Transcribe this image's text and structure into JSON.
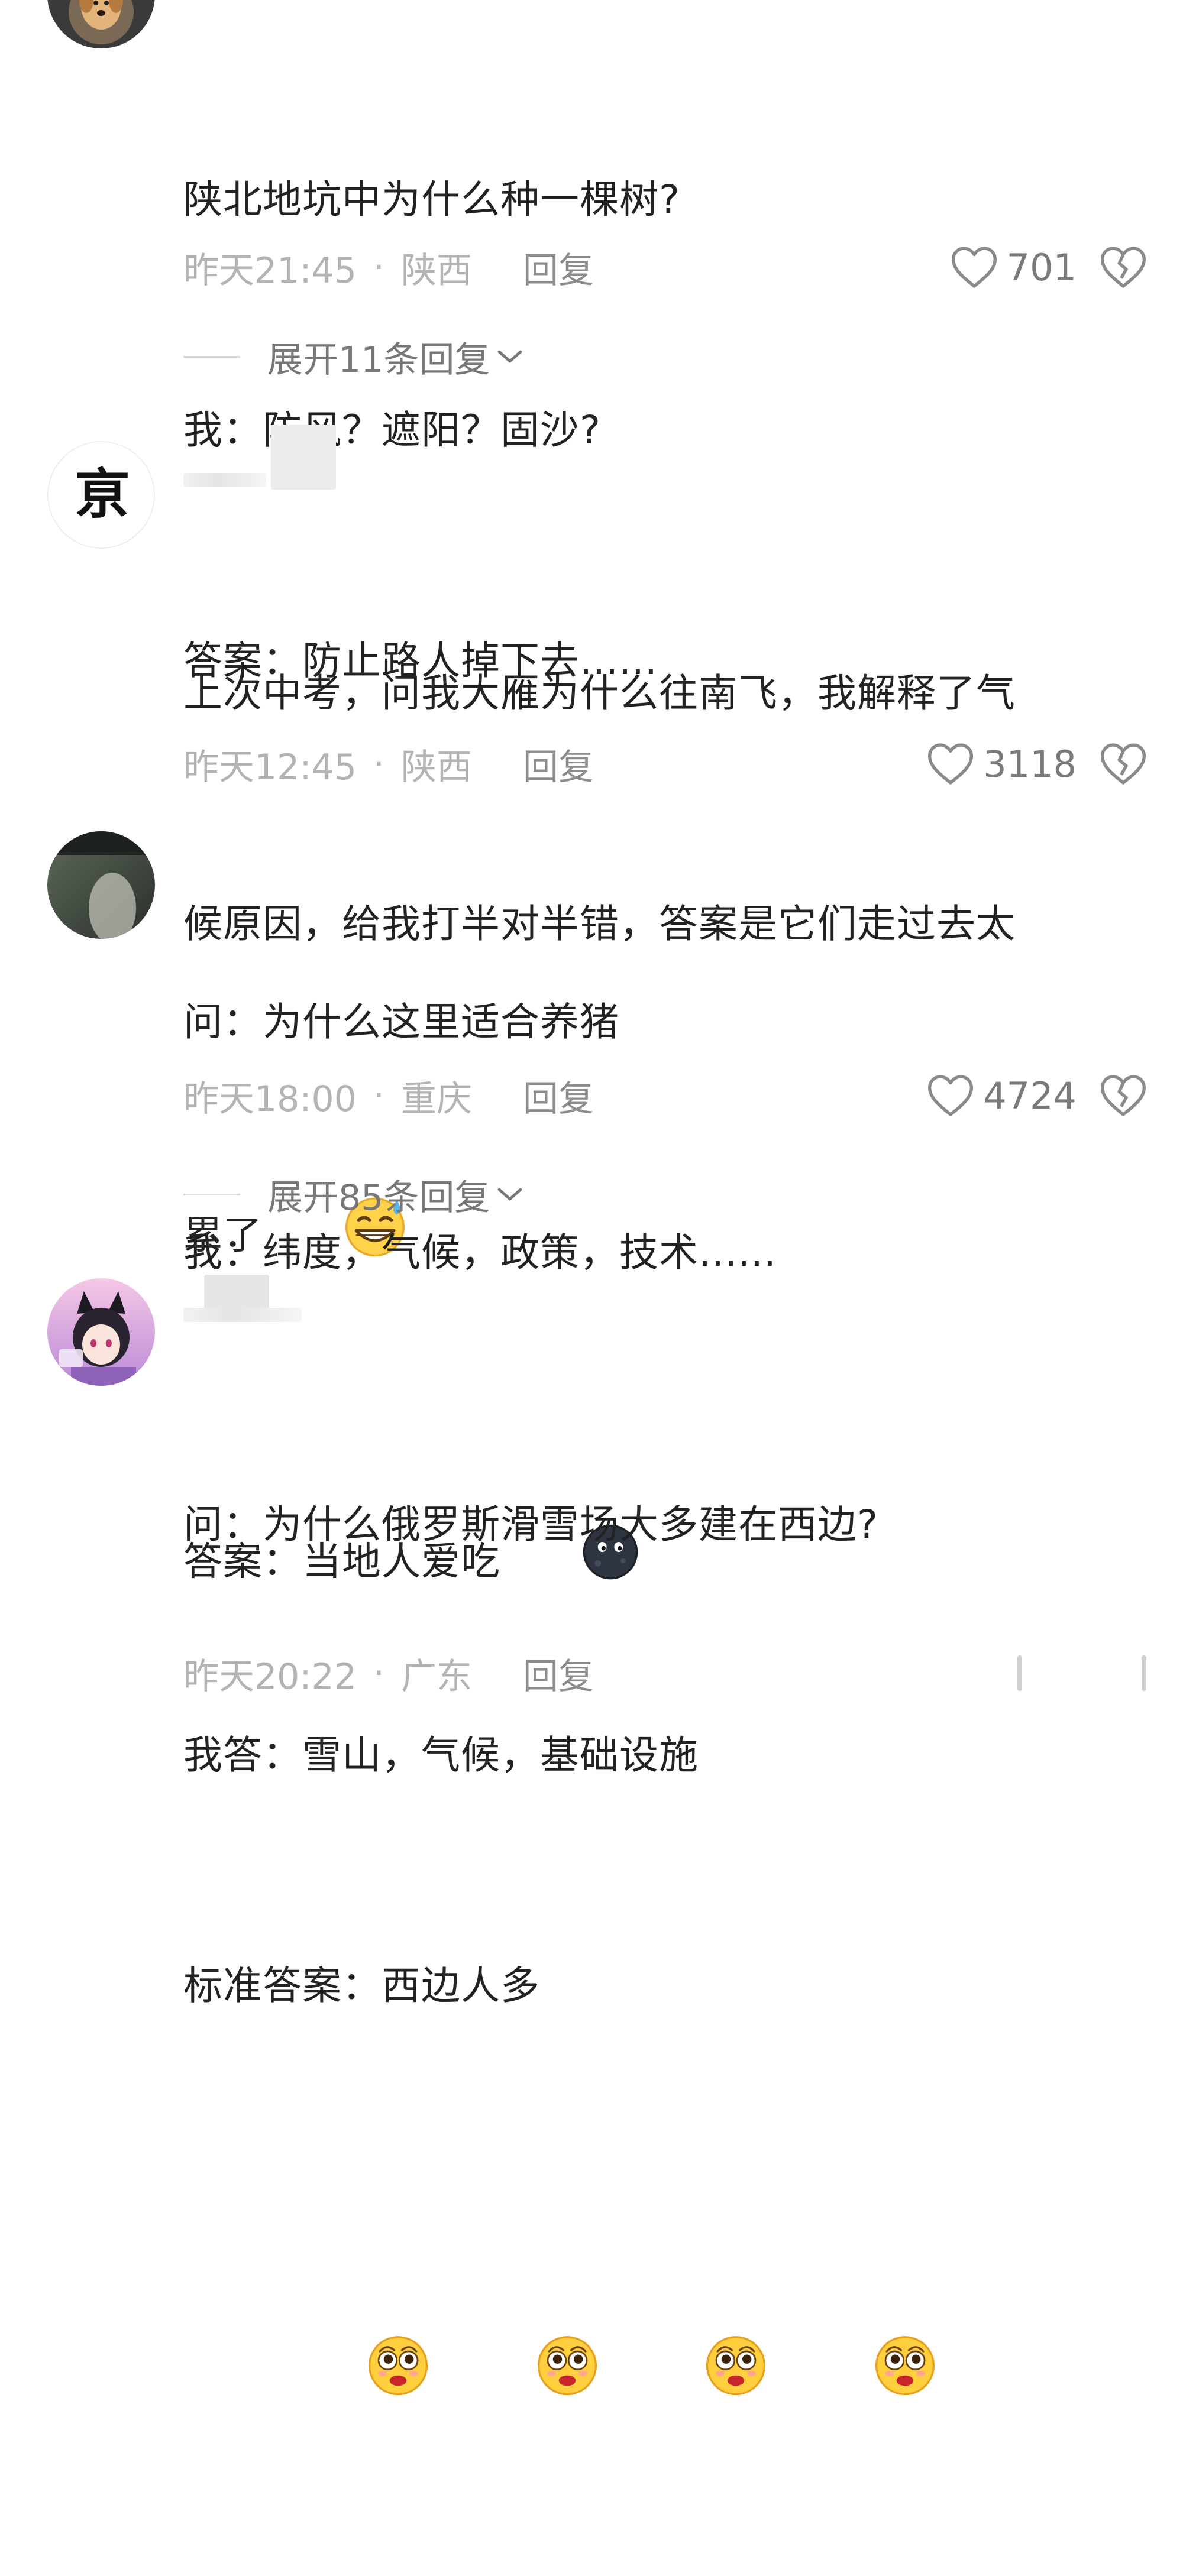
{
  "comments": [
    {
      "lines": [
        "陕北地坑中为什么种一棵树?",
        "我：防风？遮阳？固沙?",
        "答案：防止路人掉下去......"
      ],
      "time": "昨天21:45",
      "location": "陕西",
      "reply_label": "回复",
      "likes": "701",
      "expand_label": "展开11条回复"
    },
    {
      "lines": [
        "上次中考，问我大雁为什么往南飞，我解释了气",
        "候原因，给我打半对半错，答案是它们走过去太",
        "累了"
      ],
      "time": "昨天12:45",
      "location": "陕西",
      "reply_label": "回复",
      "likes": "3118"
    },
    {
      "lines": [
        "问：为什么这里适合养猪",
        "我：纬度，气候，政策，技术......",
        "答案：当地人爱吃"
      ],
      "time": "昨天18:00",
      "location": "重庆",
      "reply_label": "回复",
      "likes": "4724",
      "expand_label": "展开85条回复"
    },
    {
      "lines": [
        "问：为什么俄罗斯滑雪场大多建在西边?",
        "我答：雪山，气候，基础设施",
        "标准答案：西边人多"
      ],
      "time": "昨天20:22",
      "location": "广东",
      "reply_label": "回复"
    }
  ],
  "meta_separator": "·",
  "icons": {
    "like": "heart-outline-icon",
    "dislike": "broken-heart-icon",
    "expand": "chevron-down-icon",
    "emoji_sweat_smile": "sweat-smile-emoji",
    "emoji_dark_face": "dark-moon-face-emoji",
    "emoji_pleading": "pleading-face-emoji"
  },
  "colors": {
    "text": "#222222",
    "meta": "#b3b3b3",
    "reply": "#8c8c8c",
    "icon": "#8a8a8a"
  }
}
